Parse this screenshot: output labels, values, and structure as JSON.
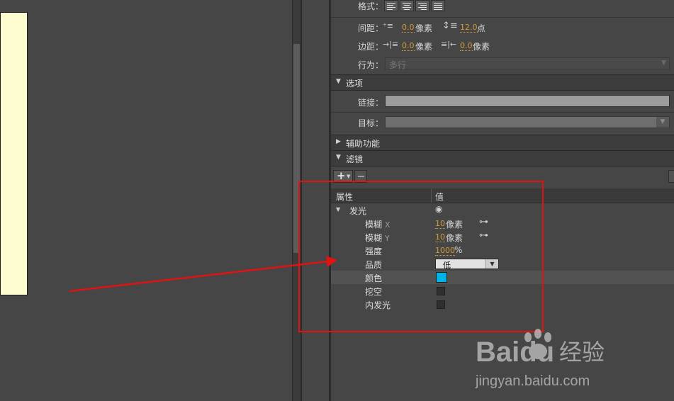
{
  "stage": {
    "canvas_color": "#fefdd0"
  },
  "paragraph": {
    "format_label": "格式：",
    "spacing_label": "间距：",
    "indent_value": "0.0",
    "indent_unit": "像素",
    "line_spacing_value": "12.0",
    "line_spacing_unit": "点",
    "margin_label": "边距：",
    "left_margin_value": "0.0",
    "left_margin_unit": "像素",
    "right_margin_value": "0.0",
    "right_margin_unit": "像素",
    "behavior_label": "行为：",
    "behavior_value": "多行"
  },
  "options": {
    "header": "选项",
    "link_label": "链接：",
    "link_value": "",
    "target_label": "目标：",
    "target_value": ""
  },
  "accessibility": {
    "header": "辅助功能"
  },
  "filters": {
    "header": "滤镜",
    "col_property": "属性",
    "col_value": "值",
    "glow": {
      "name": "发光",
      "blur_x_label": "模糊",
      "blur_x_axis": "X",
      "blur_x_value": "10",
      "blur_x_unit": "像素",
      "blur_y_label": "模糊",
      "blur_y_axis": "Y",
      "blur_y_value": "10",
      "blur_y_unit": "像素",
      "strength_label": "强度",
      "strength_value": "1000",
      "strength_unit": "%",
      "quality_label": "品质",
      "quality_value": "低",
      "color_label": "颜色",
      "color_value": "#00b4e6",
      "knockout_label": "挖空",
      "knockout_checked": false,
      "inner_glow_label": "内发光",
      "inner_glow_checked": false
    }
  },
  "annotation": {
    "color": "#e01212"
  },
  "watermark": {
    "brand": "Baidu",
    "product": "经验",
    "url": "jingyan.baidu.com"
  }
}
